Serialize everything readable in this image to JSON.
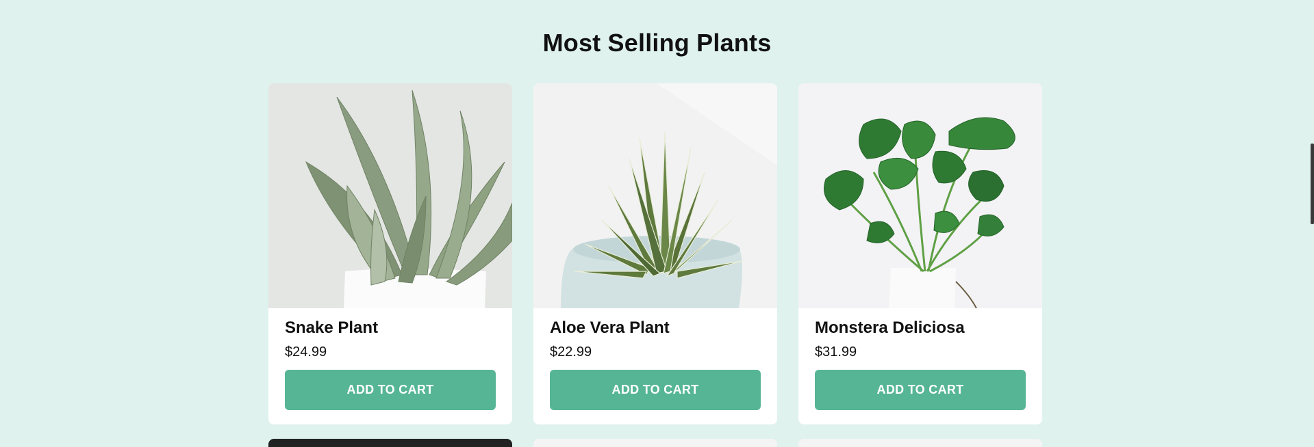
{
  "section": {
    "title": "Most Selling Plants"
  },
  "products": [
    {
      "name": "Snake Plant",
      "price": "$24.99",
      "button": "ADD TO CART",
      "image": "snake-plant-image"
    },
    {
      "name": "Aloe Vera Plant",
      "price": "$22.99",
      "button": "ADD TO CART",
      "image": "aloe-vera-image"
    },
    {
      "name": "Monstera Deliciosa",
      "price": "$31.99",
      "button": "ADD TO CART",
      "image": "monstera-image"
    }
  ],
  "colors": {
    "background": "#dff2ed",
    "button": "#55b594",
    "card": "#ffffff"
  }
}
